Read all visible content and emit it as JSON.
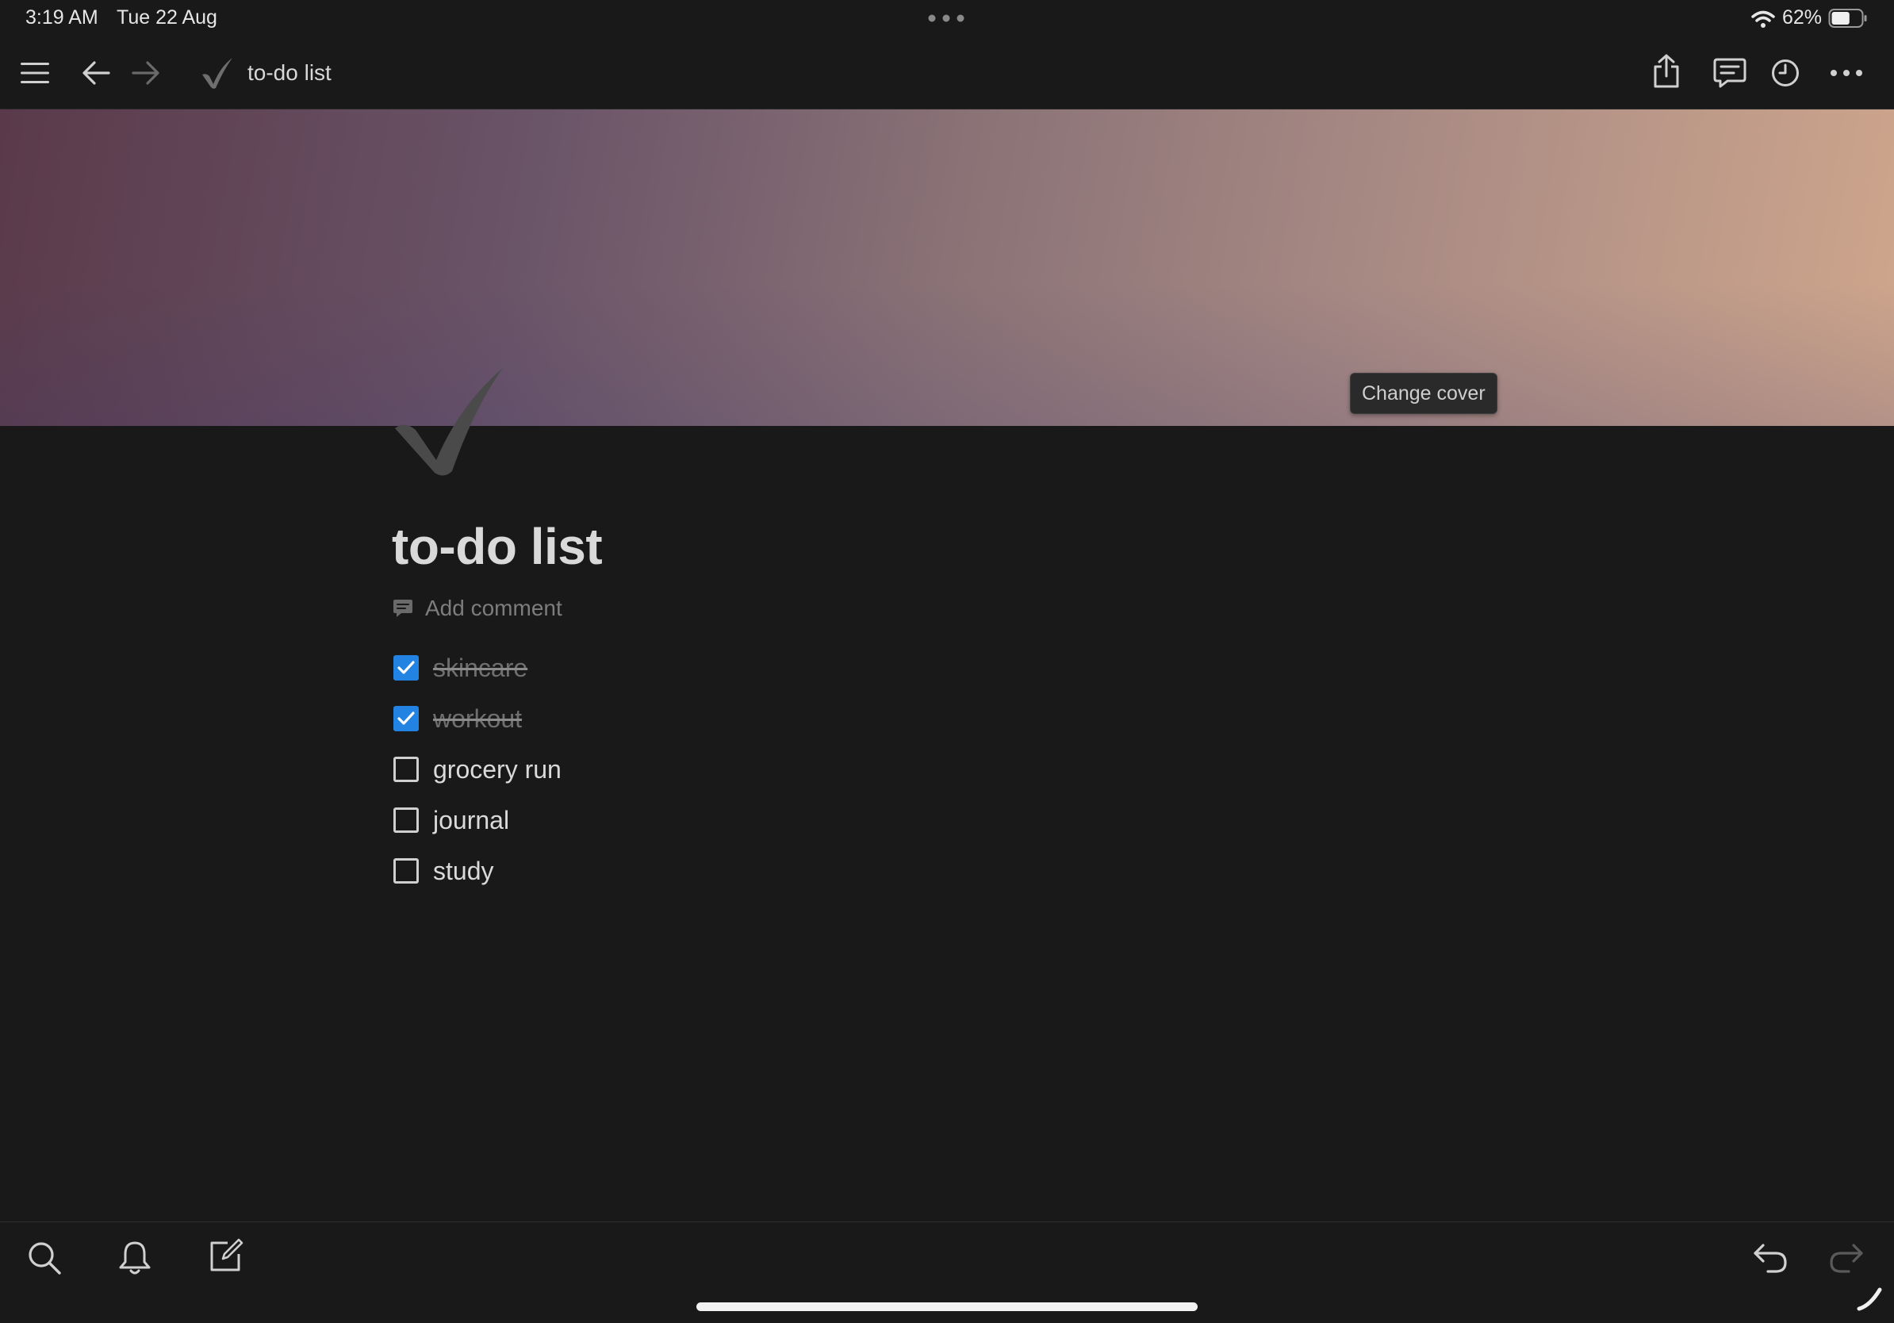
{
  "status_bar": {
    "time": "3:19 AM",
    "date": "Tue 22 Aug",
    "battery": "62%",
    "battery_level": 0.62
  },
  "toolbar": {
    "page_title": "to-do list",
    "page_icon": "check-mark-icon"
  },
  "cover": {
    "change_cover_label": "Change cover",
    "gradient_colors": [
      "#5a3a4a",
      "#6a5468",
      "#8a7276",
      "#a88a84",
      "#cfa68c"
    ]
  },
  "page": {
    "title": "to-do list",
    "add_comment_label": "Add comment",
    "todos": [
      {
        "label": "skincare ",
        "checked": true
      },
      {
        "label": "workout ",
        "checked": true
      },
      {
        "label": "grocery run",
        "checked": false
      },
      {
        "label": "journal",
        "checked": false
      },
      {
        "label": "study",
        "checked": false
      }
    ]
  },
  "colors": {
    "background": "#191919",
    "checkbox_checked": "#2383e2"
  }
}
